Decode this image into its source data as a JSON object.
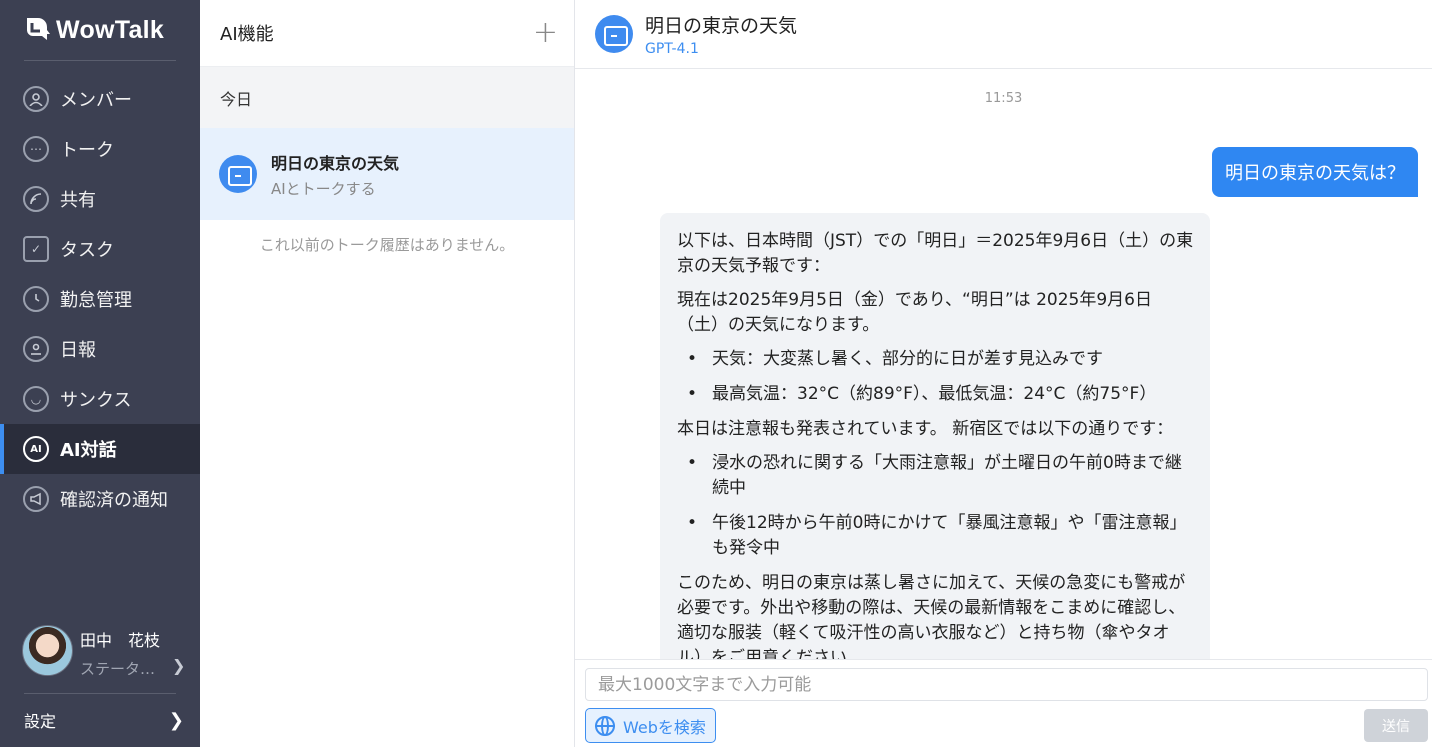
{
  "app": {
    "name": "WowTalk"
  },
  "sidebar": {
    "items": [
      {
        "label": "メンバー",
        "icon": "member-icon"
      },
      {
        "label": "トーク",
        "icon": "talk-icon"
      },
      {
        "label": "共有",
        "icon": "share-icon"
      },
      {
        "label": "タスク",
        "icon": "task-icon"
      },
      {
        "label": "勤怠管理",
        "icon": "clock-icon"
      },
      {
        "label": "日報",
        "icon": "report-icon"
      },
      {
        "label": "サンクス",
        "icon": "smile-icon"
      },
      {
        "label": "AI対話",
        "icon": "ai-icon",
        "active": true
      },
      {
        "label": "確認済の通知",
        "icon": "megaphone-icon"
      }
    ],
    "user": {
      "name": "田中　花枝",
      "status": "ステータ…"
    },
    "settings_label": "設定"
  },
  "list": {
    "title": "AI機能",
    "section": "今日",
    "conversation": {
      "title": "明日の東京の天気",
      "subtitle": "AIとトークする"
    },
    "empty_note": "これ以前のトーク履歴はありません。"
  },
  "chat": {
    "title": "明日の東京の天気",
    "model": "GPT-4.1",
    "timestamp": "11:53",
    "user_message": "明日の東京の天気は？",
    "bot": {
      "p1": "以下は、日本時間（JST）での「明日」＝2025年9月6日（土）の東京の天気予報です：",
      "p2": "現在は2025年9月5日（金）であり、“明日”は 2025年9月6日（土）の天気になります。",
      "bullets1": [
        "天気：大変蒸し暑く、部分的に日が差す見込みです",
        "最高気温：32°C（約89°F）、最低気温：24°C（約75°F）"
      ],
      "p3": "本日は注意報も発表されています。 新宿区では以下の通りです：",
      "bullets2": [
        "浸水の恐れに関する「大雨注意報」が土曜日の午前0時まで継続中",
        "午後12時から午前0時にかけて「暴風注意報」や「雷注意報」も発令中"
      ],
      "p4": "このため、明日の東京は蒸し暑さに加えて、天候の急変にも警戒が必要です。外出や移動の際は、天候の最新情報をこまめに確認し、適切な服装（軽くて吸汗性の高い衣服など）と持ち物（傘やタオル）をご用意ください。"
    },
    "input_placeholder": "最大1000文字まで入力可能",
    "web_search_label": "Webを検索",
    "send_label": "送信"
  },
  "colors": {
    "accent": "#3d8ef0",
    "sidebar_bg": "#3c4052"
  }
}
